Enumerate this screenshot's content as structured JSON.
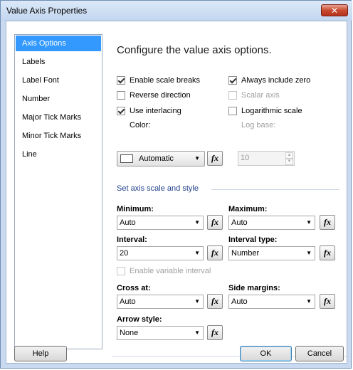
{
  "window": {
    "title": "Value Axis Properties",
    "close_label": "✕"
  },
  "nav": {
    "items": [
      {
        "label": "Axis Options",
        "selected": true
      },
      {
        "label": "Labels"
      },
      {
        "label": "Label Font"
      },
      {
        "label": "Number"
      },
      {
        "label": "Major Tick Marks"
      },
      {
        "label": "Minor Tick Marks"
      },
      {
        "label": "Line"
      }
    ]
  },
  "main": {
    "heading": "Configure the value axis options.",
    "checkboxes": {
      "enable_scale_breaks": {
        "label": "Enable scale breaks",
        "checked": true
      },
      "always_include_zero": {
        "label": "Always include zero",
        "checked": true
      },
      "reverse_direction": {
        "label": "Reverse direction",
        "checked": false
      },
      "scalar_axis": {
        "label": "Scalar axis",
        "checked": false,
        "disabled": true
      },
      "use_interlacing": {
        "label": "Use interlacing",
        "checked": true
      },
      "logarithmic_scale": {
        "label": "Logarithmic scale",
        "checked": false
      },
      "enable_variable_interval": {
        "label": "Enable variable interval",
        "checked": false,
        "disabled": true
      }
    },
    "color": {
      "label": "Color:",
      "value": "Automatic"
    },
    "log_base": {
      "label": "Log base:",
      "value": "10"
    },
    "section_title": "Set axis scale and style",
    "fields": {
      "minimum": {
        "label": "Minimum:",
        "value": "Auto"
      },
      "maximum": {
        "label": "Maximum:",
        "value": "Auto"
      },
      "interval": {
        "label": "Interval:",
        "value": "20"
      },
      "interval_type": {
        "label": "Interval type:",
        "value": "Number"
      },
      "cross_at": {
        "label": "Cross at:",
        "value": "Auto"
      },
      "side_margins": {
        "label": "Side margins:",
        "value": "Auto"
      },
      "arrow_style": {
        "label": "Arrow style:",
        "value": "None"
      }
    },
    "fx_label": "fx"
  },
  "footer": {
    "help_label": "Help",
    "ok_label": "OK",
    "cancel_label": "Cancel"
  },
  "icons": {
    "dropdown": "chevron-down-icon",
    "function": "fx-icon",
    "close": "close-icon"
  },
  "colors": {
    "selection": "#3399ff",
    "section_title": "#1f3f8c",
    "close_button": "#c84a30"
  }
}
